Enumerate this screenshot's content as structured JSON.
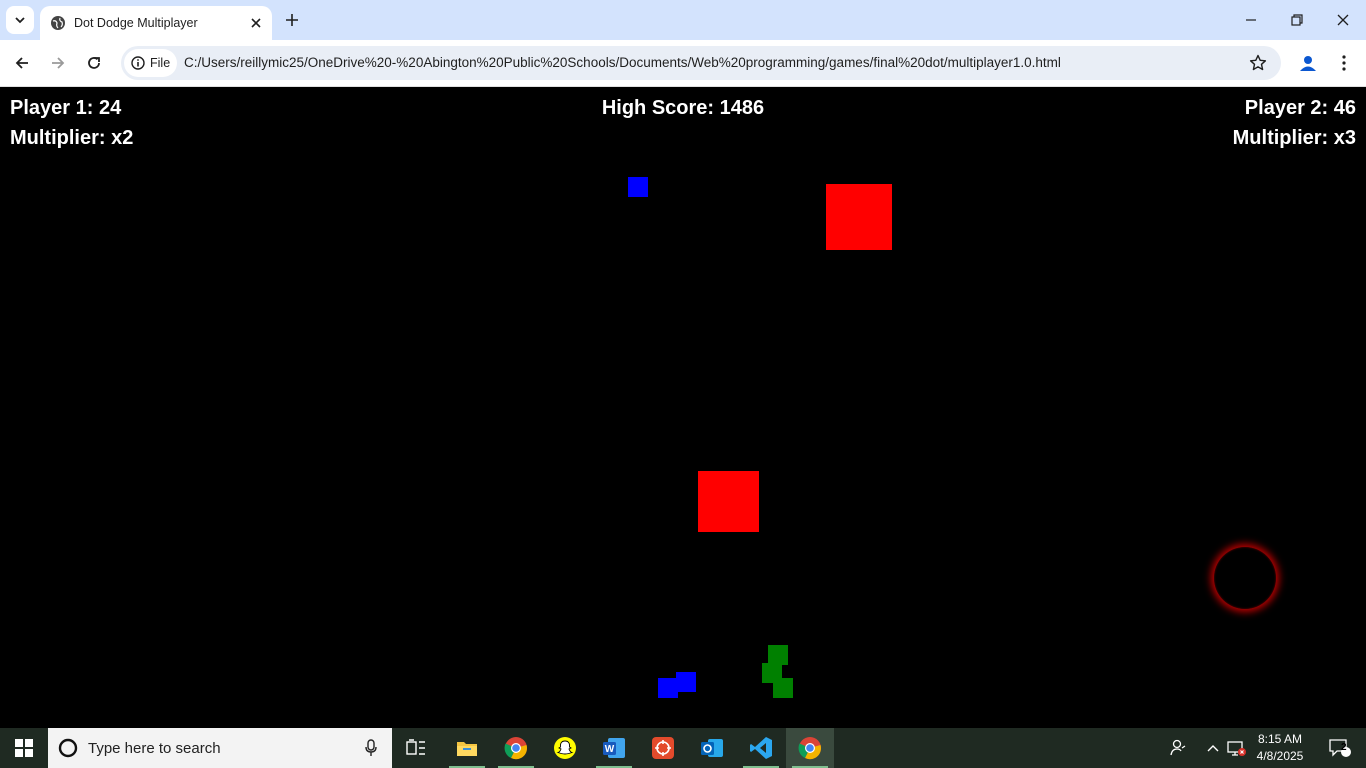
{
  "browser": {
    "tab_title": "Dot Dodge Multiplayer",
    "site_chip_label": "File",
    "url": "C:/Users/reillymic25/OneDrive%20-%20Abington%20Public%20Schools/Documents/Web%20programming/games/final%20dot/multiplayer1.0.html"
  },
  "game": {
    "player1_score": "Player 1: 24",
    "player1_multiplier": "Multiplier: x2",
    "high_score": "High Score: 1486",
    "player2_score": "Player 2: 46",
    "player2_multiplier": "Multiplier: x3",
    "colors": {
      "enemy": "#ff0000",
      "player1": "#0000ff",
      "player2": "#008000",
      "background": "#000000",
      "blackhole_glow": "#c00000"
    }
  },
  "taskbar": {
    "search_placeholder": "Type here to search",
    "apps": [
      "task-view",
      "file-explorer",
      "chrome",
      "snapchat",
      "word",
      "app-red",
      "outlook",
      "vscode",
      "chrome-active"
    ],
    "time": "8:15 AM",
    "date": "4/8/2025",
    "notification_count": "2"
  }
}
